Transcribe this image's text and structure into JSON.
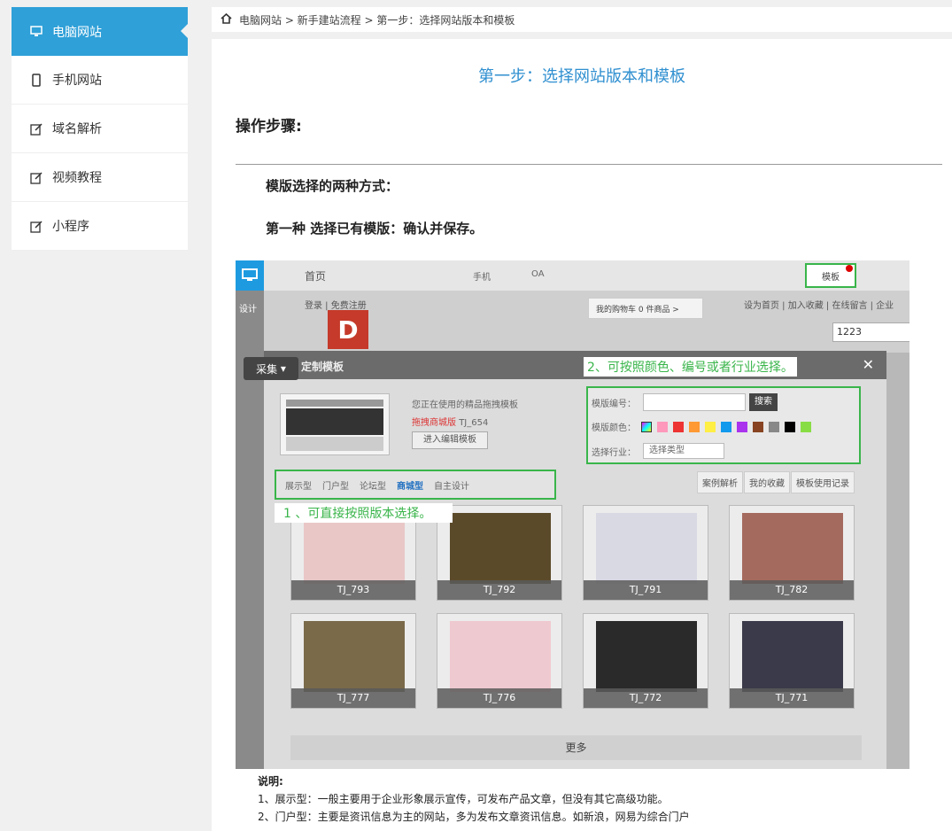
{
  "sidebar": {
    "items": [
      {
        "label": "电脑网站",
        "icon": "monitor-icon"
      },
      {
        "label": "手机网站",
        "icon": "phone-icon"
      },
      {
        "label": "域名解析",
        "icon": "edit-icon"
      },
      {
        "label": "视频教程",
        "icon": "edit-icon"
      },
      {
        "label": "小程序",
        "icon": "edit-icon"
      }
    ]
  },
  "breadcrumb": {
    "text": "电脑网站 > 新手建站流程 > 第一步：选择网站版本和模板"
  },
  "main": {
    "title": "第一步：选择网站版本和模板",
    "steps_heading": "操作步骤:",
    "h_ways": "模版选择的两种方式：",
    "h_first": "第一种 选择已有模版：确认并保存。"
  },
  "shot": {
    "page": "首页",
    "tab_phone": "手机",
    "tab_oa": "OA",
    "tpl": "模板",
    "design": "设计",
    "login": "登录 | 免费注册",
    "cart": "我的购物车 0 件商品 >",
    "links": "设为首页 | 加入收藏 | 在线留言 | 企业",
    "num": "1223",
    "caiji": "采集",
    "modal_title": "定制模板",
    "note2": "2、可按照颜色、编号或者行业选择。",
    "cur_line1": "您正在使用的精品拖拽模板",
    "cur_line2_red": "拖拽商城版",
    "cur_line2": "TJ_654",
    "cur_btn": "进入编辑模板",
    "f_code": "模版编号：",
    "f_search": "搜索",
    "f_color": "模版颜色：",
    "f_ind": "选择行业：",
    "f_sel": "选择类型",
    "cats": [
      "展示型",
      "门户型",
      "论坛型",
      "商城型",
      "自主设计"
    ],
    "right_tabs": [
      "案例解析",
      "我的收藏",
      "模板使用记录"
    ],
    "note1": "1 、可直接按照版本选择。",
    "cards": [
      "TJ_793",
      "TJ_792",
      "TJ_791",
      "TJ_782",
      "TJ_777",
      "TJ_776",
      "TJ_772",
      "TJ_771"
    ],
    "more": "更多"
  },
  "desc": {
    "head": "说明:",
    "l1": "1、展示型：一般主要用于企业形象展示宣传，可发布产品文章，但没有其它高级功能。",
    "l2": "2、门户型：主要是资讯信息为主的网站，多为发布文章资讯信息。如新浪，网易为综合门户"
  },
  "colors": {
    "accent": "#2fa0d8",
    "annot": "#39b54a"
  }
}
